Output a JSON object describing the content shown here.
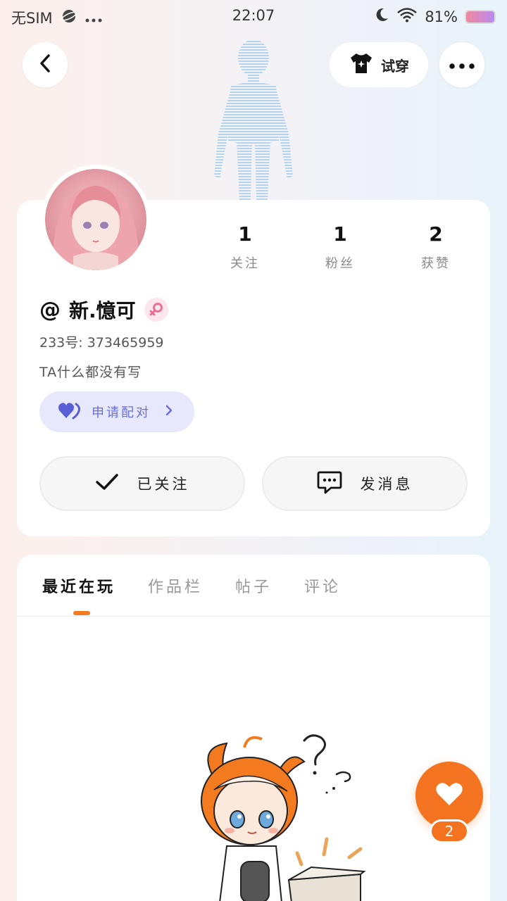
{
  "status_bar": {
    "carrier": "无SIM",
    "time": "22:07",
    "battery": "81%"
  },
  "header": {
    "tryon_label": "试穿"
  },
  "profile": {
    "stats": [
      {
        "value": "1",
        "label": "关注"
      },
      {
        "value": "1",
        "label": "粉丝"
      },
      {
        "value": "2",
        "label": "获赞"
      }
    ],
    "name_prefix": "@",
    "name": "新.憶可",
    "uid": "233号: 373465959",
    "bio": "TA什么都没有写",
    "pair_label": "申请配对",
    "follow_label": "已关注",
    "message_label": "发消息"
  },
  "tabs": [
    {
      "label": "最近在玩",
      "active": true
    },
    {
      "label": "作品栏",
      "active": false
    },
    {
      "label": "帖子",
      "active": false
    },
    {
      "label": "评论",
      "active": false
    }
  ],
  "fab": {
    "count": "2"
  },
  "colors": {
    "accent": "#f47320",
    "pair_bg": "#e7e8fb",
    "pair_text": "#6a6fd8"
  }
}
